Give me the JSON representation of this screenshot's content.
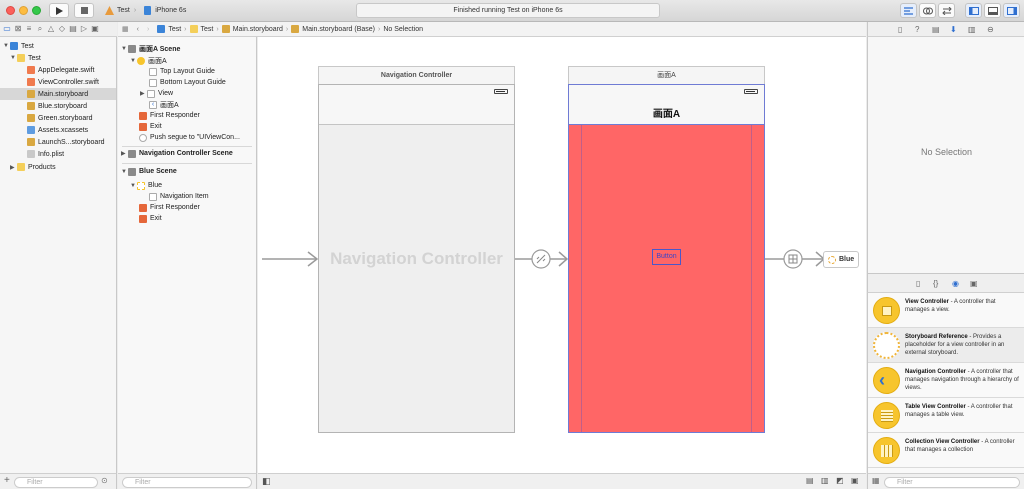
{
  "toolbar": {
    "scheme_target": "Test",
    "scheme_device": "iPhone 6s",
    "activity_status": "Finished running Test on iPhone 6s"
  },
  "navigator": {
    "items": [
      {
        "label": "Test",
        "kind": "project"
      },
      {
        "label": "Test",
        "kind": "folder"
      },
      {
        "label": "AppDelegate.swift",
        "kind": "swift"
      },
      {
        "label": "ViewController.swift",
        "kind": "swift"
      },
      {
        "label": "Main.storyboard",
        "kind": "storyboard"
      },
      {
        "label": "Blue.storyboard",
        "kind": "storyboard"
      },
      {
        "label": "Green.storyboard",
        "kind": "storyboard"
      },
      {
        "label": "Assets.xcassets",
        "kind": "assets"
      },
      {
        "label": "LaunchS...storyboard",
        "kind": "storyboard"
      },
      {
        "label": "Info.plist",
        "kind": "plist"
      },
      {
        "label": "Products",
        "kind": "folder"
      }
    ],
    "filter_placeholder": "Filter"
  },
  "jumpbar": {
    "crumbs": [
      "Test",
      "Test",
      "Main.storyboard",
      "Main.storyboard (Base)",
      "No Selection"
    ]
  },
  "outline": {
    "items": [
      {
        "label": "画面A Scene",
        "bold": true
      },
      {
        "label": "画面A",
        "bold": false
      },
      {
        "label": "Top Layout Guide",
        "bold": false
      },
      {
        "label": "Bottom Layout Guide",
        "bold": false
      },
      {
        "label": "View",
        "bold": false
      },
      {
        "label": "画面A",
        "bold": false
      },
      {
        "label": "First Responder",
        "bold": false
      },
      {
        "label": "Exit",
        "bold": false
      },
      {
        "label": "Push segue to \"UIViewCon...",
        "bold": false
      },
      {
        "label": "Navigation Controller Scene",
        "bold": true
      },
      {
        "label": "Blue Scene",
        "bold": true
      },
      {
        "label": "Blue",
        "bold": false
      },
      {
        "label": "Navigation Item",
        "bold": false
      },
      {
        "label": "First Responder",
        "bold": false
      },
      {
        "label": "Exit",
        "bold": false
      }
    ],
    "filter_placeholder": "Filter"
  },
  "canvas": {
    "nav_controller_title": "Navigation Controller",
    "nav_controller_watermark": "Navigation Controller",
    "scene_a_title": "画面A",
    "scene_a_nav_title": "画面A",
    "scene_a_button": "Button",
    "blue_ref_label": "Blue",
    "scene_a_color": "#ff6666"
  },
  "inspector": {
    "empty_text": "No Selection"
  },
  "library": {
    "items": [
      {
        "name": "View Controller",
        "desc": " - A controller that manages a view."
      },
      {
        "name": "Storyboard Reference",
        "desc": " - Provides a placeholder for a view controller in an external storyboard."
      },
      {
        "name": "Navigation Controller",
        "desc": " - A controller that manages navigation through a hierarchy of views."
      },
      {
        "name": "Table View Controller",
        "desc": " - A controller that manages a table view."
      },
      {
        "name": "Collection View Controller",
        "desc": " - A controller that manages a collection"
      }
    ],
    "filter_placeholder": "Filter"
  }
}
